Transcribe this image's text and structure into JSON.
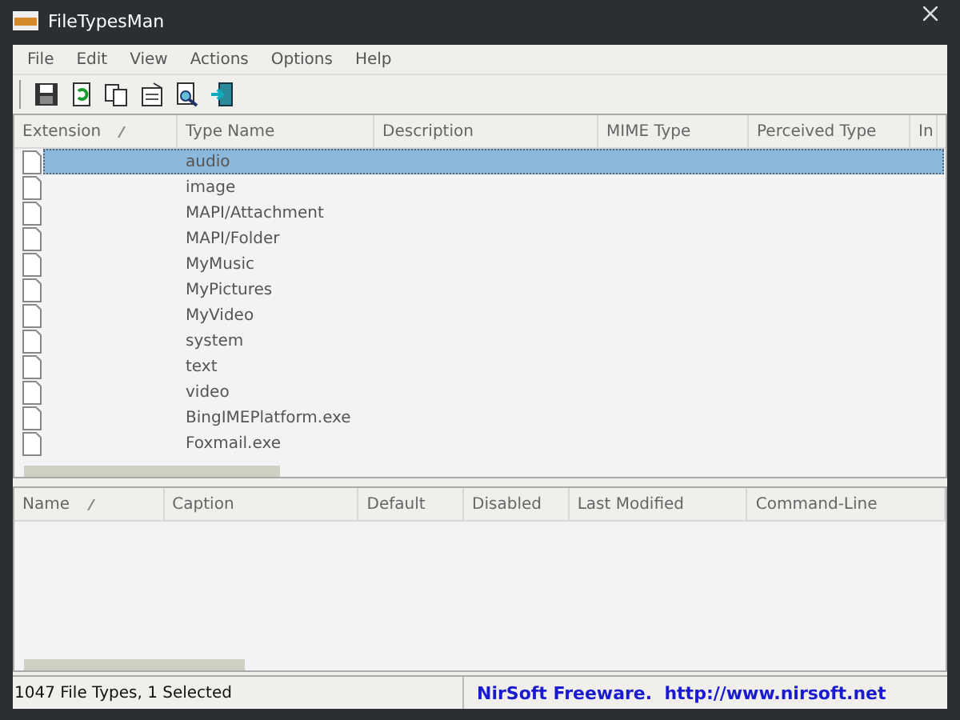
{
  "window": {
    "title": "FileTypesMan"
  },
  "menu": [
    "File",
    "Edit",
    "View",
    "Actions",
    "Options",
    "Help"
  ],
  "file_types": {
    "columns": [
      {
        "label": "Extension",
        "sorted": true
      },
      {
        "label": "Type Name",
        "sorted": false
      },
      {
        "label": "Description",
        "sorted": false
      },
      {
        "label": "MIME Type",
        "sorted": false
      },
      {
        "label": "Perceived Type",
        "sorted": false
      },
      {
        "label": "In"
      }
    ],
    "rows": [
      {
        "type_name": "audio",
        "selected": true
      },
      {
        "type_name": "image",
        "selected": false
      },
      {
        "type_name": "MAPI/Attachment",
        "selected": false
      },
      {
        "type_name": "MAPI/Folder",
        "selected": false
      },
      {
        "type_name": "MyMusic",
        "selected": false
      },
      {
        "type_name": "MyPictures",
        "selected": false
      },
      {
        "type_name": "MyVideo",
        "selected": false
      },
      {
        "type_name": "system",
        "selected": false
      },
      {
        "type_name": "text",
        "selected": false
      },
      {
        "type_name": "video",
        "selected": false
      },
      {
        "type_name": "BingIMEPlatform.exe",
        "selected": false
      },
      {
        "type_name": "Foxmail.exe",
        "selected": false
      }
    ]
  },
  "actions": {
    "columns": [
      {
        "label": "Name",
        "sorted": true
      },
      {
        "label": "Caption",
        "sorted": false
      },
      {
        "label": "Default",
        "sorted": false
      },
      {
        "label": "Disabled",
        "sorted": false
      },
      {
        "label": "Last Modified",
        "sorted": false
      },
      {
        "label": "Command-Line",
        "sorted": false
      }
    ]
  },
  "status_bar": {
    "summary": "1047 File Types, 1 Selected",
    "credit": "NirSoft Freeware.  http://www.nirsoft.net"
  }
}
